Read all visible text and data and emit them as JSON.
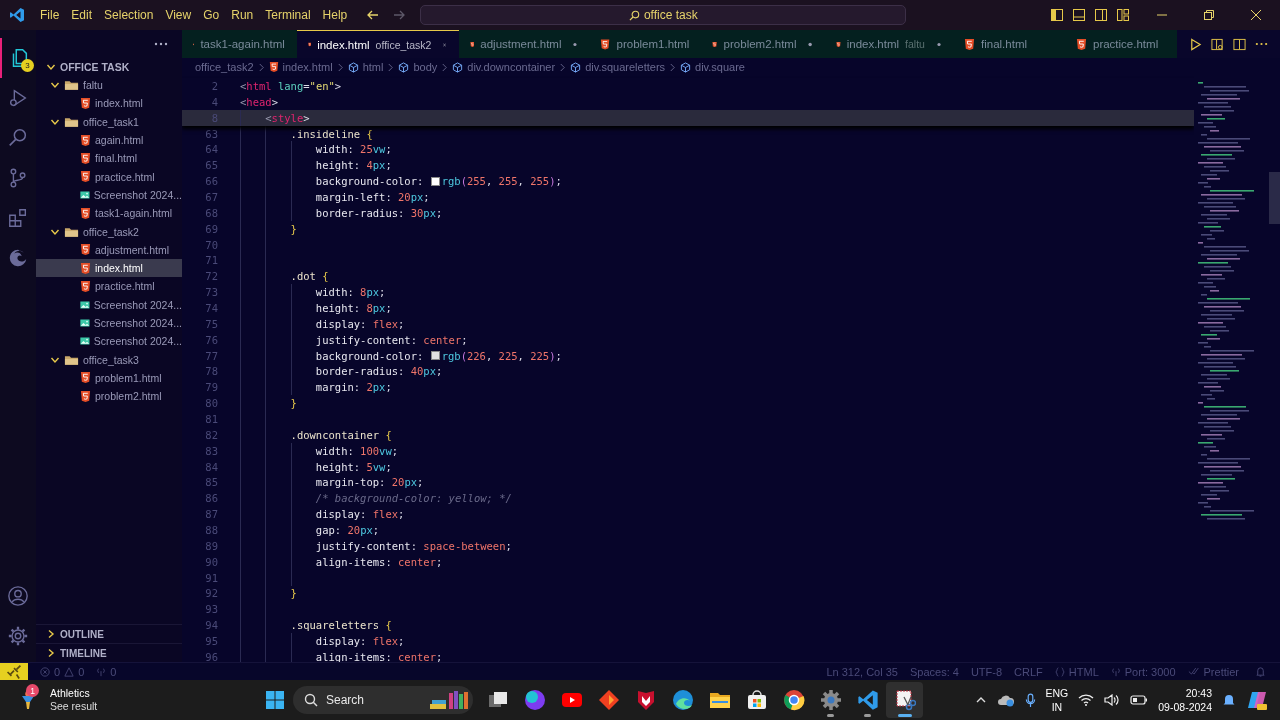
{
  "title_bar": {
    "menu": [
      "File",
      "Edit",
      "Selection",
      "View",
      "Go",
      "Run",
      "Terminal",
      "Help"
    ],
    "command_center": "office task"
  },
  "activity_bar": {
    "badge": "3"
  },
  "sidebar": {
    "section": {
      "title": "OFFICE TASK",
      "expanded": true
    },
    "tree": [
      {
        "name": "faltu",
        "kind": "folder",
        "expanded": true,
        "selected": false,
        "children": [
          {
            "name": "index.html",
            "kind": "html",
            "selected": false
          }
        ]
      },
      {
        "name": "office_task1",
        "kind": "folder",
        "expanded": true,
        "selected": false,
        "children": [
          {
            "name": "again.html",
            "kind": "html",
            "selected": false
          },
          {
            "name": "final.html",
            "kind": "html",
            "selected": false
          },
          {
            "name": "practice.html",
            "kind": "html",
            "selected": false
          },
          {
            "name": "Screenshot 2024...",
            "kind": "image",
            "selected": false
          },
          {
            "name": "task1-again.html",
            "kind": "html",
            "selected": false
          }
        ]
      },
      {
        "name": "office_task2",
        "kind": "folder",
        "expanded": true,
        "selected": false,
        "children": [
          {
            "name": "adjustment.html",
            "kind": "html",
            "selected": false
          },
          {
            "name": "index.html",
            "kind": "html",
            "selected": true
          },
          {
            "name": "practice.html",
            "kind": "html",
            "selected": false
          },
          {
            "name": "Screenshot 2024...",
            "kind": "image",
            "selected": false
          },
          {
            "name": "Screenshot 2024...",
            "kind": "image",
            "selected": false
          },
          {
            "name": "Screenshot 2024...",
            "kind": "image",
            "selected": false
          }
        ]
      },
      {
        "name": "office_task3",
        "kind": "folder",
        "expanded": true,
        "selected": false,
        "children": [
          {
            "name": "problem1.html",
            "kind": "html",
            "selected": false
          },
          {
            "name": "problem2.html",
            "kind": "html",
            "selected": false
          }
        ]
      }
    ],
    "panels": [
      {
        "title": "OUTLINE",
        "expanded": false
      },
      {
        "title": "TIMELINE",
        "expanded": false
      }
    ]
  },
  "tabs": [
    {
      "label": "task1-again.html",
      "selected": false,
      "modified": false
    },
    {
      "label": "index.html",
      "description": "office_task2",
      "selected": true,
      "modified": false
    },
    {
      "label": "adjustment.html",
      "selected": false,
      "modified": true
    },
    {
      "label": "problem1.html",
      "selected": false,
      "modified": false
    },
    {
      "label": "problem2.html",
      "selected": false,
      "modified": true
    },
    {
      "label": "index.html",
      "description": "faltu",
      "selected": false,
      "modified": true
    },
    {
      "label": "final.html",
      "selected": false,
      "modified": false
    },
    {
      "label": "practice.html",
      "selected": false,
      "modified": false
    }
  ],
  "breadcrumbs": [
    {
      "kind": "folder",
      "text": "office_task2"
    },
    {
      "kind": "file",
      "text": "index.html"
    },
    {
      "kind": "element",
      "text": "html"
    },
    {
      "kind": "element",
      "text": "body"
    },
    {
      "kind": "element",
      "text": "div.downcontainer"
    },
    {
      "kind": "element",
      "text": "div.squareletters"
    },
    {
      "kind": "element",
      "text": "div.square"
    }
  ],
  "editor": {
    "sticky_lines": [
      {
        "number": "2",
        "kind": "root",
        "highlighted": false,
        "tokens": [
          {
            "kind": "p",
            "text": "<"
          },
          {
            "kind": "tag",
            "text": "html"
          },
          {
            "kind": "attr",
            "text": " lang"
          },
          {
            "kind": "p",
            "text": "="
          },
          {
            "kind": "str",
            "text": "\"en\""
          },
          {
            "kind": "p",
            "text": ">"
          }
        ]
      },
      {
        "number": "4",
        "kind": "root",
        "highlighted": false,
        "tokens": [
          {
            "kind": "p",
            "text": "<"
          },
          {
            "kind": "tag",
            "text": "head"
          },
          {
            "kind": "p",
            "text": ">"
          }
        ]
      },
      {
        "number": "8",
        "kind": "element",
        "highlighted": true,
        "tokens": [
          {
            "kind": "p",
            "text": "<"
          },
          {
            "kind": "tag",
            "text": "style"
          },
          {
            "kind": "p",
            "text": ">"
          }
        ]
      }
    ],
    "lines": [
      {
        "number": "63",
        "kind": "rule",
        "tokens": [
          {
            "kind": "sel",
            "text": ".insideline "
          },
          {
            "kind": "brace",
            "text": "{"
          }
        ]
      },
      {
        "number": "64",
        "kind": "declaration",
        "tokens": [
          {
            "kind": "prop",
            "text": "width"
          },
          {
            "kind": "p",
            "text": ": "
          },
          {
            "kind": "num",
            "text": "25"
          },
          {
            "kind": "unit",
            "text": "vw"
          },
          {
            "kind": "p",
            "text": ";"
          }
        ]
      },
      {
        "number": "65",
        "kind": "declaration",
        "tokens": [
          {
            "kind": "prop",
            "text": "height"
          },
          {
            "kind": "p",
            "text": ": "
          },
          {
            "kind": "num",
            "text": "4"
          },
          {
            "kind": "unit",
            "text": "px"
          },
          {
            "kind": "p",
            "text": ";"
          }
        ]
      },
      {
        "number": "66",
        "kind": "declaration",
        "tokens": [
          {
            "kind": "prop",
            "text": "background-color"
          },
          {
            "kind": "p",
            "text": ": "
          },
          {
            "kind": "swatch",
            "color": "#ffffff"
          },
          {
            "kind": "fn",
            "text": "rgb"
          },
          {
            "kind": "paren",
            "text": "("
          },
          {
            "kind": "num",
            "text": "255"
          },
          {
            "kind": "p",
            "text": ", "
          },
          {
            "kind": "num",
            "text": "255"
          },
          {
            "kind": "p",
            "text": ", "
          },
          {
            "kind": "num",
            "text": "255"
          },
          {
            "kind": "paren",
            "text": ")"
          },
          {
            "kind": "p",
            "text": ";"
          }
        ]
      },
      {
        "number": "67",
        "kind": "declaration",
        "tokens": [
          {
            "kind": "prop",
            "text": "margin-left"
          },
          {
            "kind": "p",
            "text": ": "
          },
          {
            "kind": "num",
            "text": "20"
          },
          {
            "kind": "unit",
            "text": "px"
          },
          {
            "kind": "p",
            "text": ";"
          }
        ]
      },
      {
        "number": "68",
        "kind": "declaration",
        "tokens": [
          {
            "kind": "prop",
            "text": "border-radius"
          },
          {
            "kind": "p",
            "text": ": "
          },
          {
            "kind": "num",
            "text": "30"
          },
          {
            "kind": "unit",
            "text": "px"
          },
          {
            "kind": "p",
            "text": ";"
          }
        ]
      },
      {
        "number": "69",
        "kind": "rule",
        "tokens": [
          {
            "kind": "brace",
            "text": "}"
          }
        ]
      },
      {
        "number": "70",
        "kind": "rule"
      },
      {
        "number": "71",
        "kind": "rule"
      },
      {
        "number": "72",
        "kind": "rule",
        "tokens": [
          {
            "kind": "sel",
            "text": ".dot "
          },
          {
            "kind": "brace",
            "text": "{"
          }
        ]
      },
      {
        "number": "73",
        "kind": "declaration",
        "tokens": [
          {
            "kind": "prop",
            "text": "width"
          },
          {
            "kind": "p",
            "text": ": "
          },
          {
            "kind": "num",
            "text": "8"
          },
          {
            "kind": "unit",
            "text": "px"
          },
          {
            "kind": "p",
            "text": ";"
          }
        ]
      },
      {
        "number": "74",
        "kind": "declaration",
        "tokens": [
          {
            "kind": "prop",
            "text": "height"
          },
          {
            "kind": "p",
            "text": ": "
          },
          {
            "kind": "num",
            "text": "8"
          },
          {
            "kind": "unit",
            "text": "px"
          },
          {
            "kind": "p",
            "text": ";"
          }
        ]
      },
      {
        "number": "75",
        "kind": "declaration",
        "tokens": [
          {
            "kind": "prop",
            "text": "display"
          },
          {
            "kind": "p",
            "text": ": "
          },
          {
            "kind": "val",
            "text": "flex"
          },
          {
            "kind": "p",
            "text": ";"
          }
        ]
      },
      {
        "number": "76",
        "kind": "declaration",
        "tokens": [
          {
            "kind": "prop",
            "text": "justify-content"
          },
          {
            "kind": "p",
            "text": ": "
          },
          {
            "kind": "val",
            "text": "center"
          },
          {
            "kind": "p",
            "text": ";"
          }
        ]
      },
      {
        "number": "77",
        "kind": "declaration",
        "tokens": [
          {
            "kind": "prop",
            "text": "background-color"
          },
          {
            "kind": "p",
            "text": ": "
          },
          {
            "kind": "swatch",
            "color": "#e2e1e1"
          },
          {
            "kind": "fn",
            "text": "rgb"
          },
          {
            "kind": "paren",
            "text": "("
          },
          {
            "kind": "num",
            "text": "226"
          },
          {
            "kind": "p",
            "text": ", "
          },
          {
            "kind": "num",
            "text": "225"
          },
          {
            "kind": "p",
            "text": ", "
          },
          {
            "kind": "num",
            "text": "225"
          },
          {
            "kind": "paren",
            "text": ")"
          },
          {
            "kind": "p",
            "text": ";"
          }
        ]
      },
      {
        "number": "78",
        "kind": "declaration",
        "tokens": [
          {
            "kind": "prop",
            "text": "border-radius"
          },
          {
            "kind": "p",
            "text": ": "
          },
          {
            "kind": "num",
            "text": "40"
          },
          {
            "kind": "unit",
            "text": "px"
          },
          {
            "kind": "p",
            "text": ";"
          }
        ]
      },
      {
        "number": "79",
        "kind": "declaration",
        "tokens": [
          {
            "kind": "prop",
            "text": "margin"
          },
          {
            "kind": "p",
            "text": ": "
          },
          {
            "kind": "num",
            "text": "2"
          },
          {
            "kind": "unit",
            "text": "px"
          },
          {
            "kind": "p",
            "text": ";"
          }
        ]
      },
      {
        "number": "80",
        "kind": "rule",
        "tokens": [
          {
            "kind": "brace",
            "text": "}"
          }
        ]
      },
      {
        "number": "81",
        "kind": "rule"
      },
      {
        "number": "82",
        "kind": "rule",
        "tokens": [
          {
            "kind": "sel",
            "text": ".downcontainer "
          },
          {
            "kind": "brace",
            "text": "{"
          }
        ]
      },
      {
        "number": "83",
        "kind": "declaration",
        "tokens": [
          {
            "kind": "prop",
            "text": "width"
          },
          {
            "kind": "p",
            "text": ": "
          },
          {
            "kind": "num",
            "text": "100"
          },
          {
            "kind": "unit",
            "text": "vw"
          },
          {
            "kind": "p",
            "text": ";"
          }
        ]
      },
      {
        "number": "84",
        "kind": "declaration",
        "tokens": [
          {
            "kind": "prop",
            "text": "height"
          },
          {
            "kind": "p",
            "text": ": "
          },
          {
            "kind": "num",
            "text": "5"
          },
          {
            "kind": "unit",
            "text": "vw"
          },
          {
            "kind": "p",
            "text": ";"
          }
        ]
      },
      {
        "number": "85",
        "kind": "declaration",
        "tokens": [
          {
            "kind": "prop",
            "text": "margin-top"
          },
          {
            "kind": "p",
            "text": ": "
          },
          {
            "kind": "num",
            "text": "20"
          },
          {
            "kind": "unit",
            "text": "px"
          },
          {
            "kind": "p",
            "text": ";"
          }
        ]
      },
      {
        "number": "86",
        "kind": "declaration",
        "tokens": [
          {
            "kind": "comment",
            "text": "/* background-color: yellow; */"
          }
        ]
      },
      {
        "number": "87",
        "kind": "declaration",
        "tokens": [
          {
            "kind": "prop",
            "text": "display"
          },
          {
            "kind": "p",
            "text": ": "
          },
          {
            "kind": "val",
            "text": "flex"
          },
          {
            "kind": "p",
            "text": ";"
          }
        ]
      },
      {
        "number": "88",
        "kind": "declaration",
        "tokens": [
          {
            "kind": "prop",
            "text": "gap"
          },
          {
            "kind": "p",
            "text": ": "
          },
          {
            "kind": "num",
            "text": "20"
          },
          {
            "kind": "unit",
            "text": "px"
          },
          {
            "kind": "p",
            "text": ";"
          }
        ]
      },
      {
        "number": "89",
        "kind": "declaration",
        "tokens": [
          {
            "kind": "prop",
            "text": "justify-content"
          },
          {
            "kind": "p",
            "text": ": "
          },
          {
            "kind": "val",
            "text": "space-between"
          },
          {
            "kind": "p",
            "text": ";"
          }
        ]
      },
      {
        "number": "90",
        "kind": "declaration",
        "tokens": [
          {
            "kind": "prop",
            "text": "align-items"
          },
          {
            "kind": "p",
            "text": ": "
          },
          {
            "kind": "val",
            "text": "center"
          },
          {
            "kind": "p",
            "text": ";"
          }
        ]
      },
      {
        "number": "91",
        "kind": "declaration"
      },
      {
        "number": "92",
        "kind": "rule",
        "tokens": [
          {
            "kind": "brace",
            "text": "}"
          }
        ]
      },
      {
        "number": "93",
        "kind": "rule"
      },
      {
        "number": "94",
        "kind": "rule",
        "tokens": [
          {
            "kind": "sel",
            "text": ".squareletters "
          },
          {
            "kind": "brace",
            "text": "{"
          }
        ]
      },
      {
        "number": "95",
        "kind": "declaration",
        "tokens": [
          {
            "kind": "prop",
            "text": "display"
          },
          {
            "kind": "p",
            "text": ": "
          },
          {
            "kind": "val",
            "text": "flex"
          },
          {
            "kind": "p",
            "text": ";"
          }
        ]
      },
      {
        "number": "96",
        "kind": "declaration",
        "tokens": [
          {
            "kind": "prop",
            "text": "align-items"
          },
          {
            "kind": "p",
            "text": ": "
          },
          {
            "kind": "val",
            "text": "center"
          },
          {
            "kind": "p",
            "text": ";"
          }
        ]
      }
    ]
  },
  "status_bar": {
    "errors": "0",
    "warnings": "0",
    "ports": "0",
    "items": [
      {
        "kind": "text",
        "text": "Ln 312, Col 35"
      },
      {
        "kind": "text",
        "text": "Spaces: 4"
      },
      {
        "kind": "text",
        "text": "UTF-8"
      },
      {
        "kind": "text",
        "text": "CRLF"
      },
      {
        "kind": "language",
        "text": "HTML"
      },
      {
        "kind": "port",
        "text": "Port: 3000"
      },
      {
        "kind": "formatter",
        "text": "Prettier"
      }
    ]
  },
  "taskbar": {
    "widget": {
      "title": "Athletics",
      "subtitle": "See result",
      "badge": "1"
    },
    "search": {
      "label": "Search"
    },
    "apps": [
      {
        "kind": "task-view",
        "running": false,
        "active": false
      },
      {
        "kind": "circle",
        "running": false,
        "active": false
      },
      {
        "kind": "play",
        "running": false,
        "active": false
      },
      {
        "kind": "diamond",
        "running": false,
        "active": false
      },
      {
        "kind": "shield",
        "running": false,
        "active": false
      },
      {
        "kind": "swirl",
        "running": false,
        "active": false
      },
      {
        "kind": "folder",
        "running": false,
        "active": false
      },
      {
        "kind": "store",
        "running": false,
        "active": false
      },
      {
        "kind": "ring",
        "running": false,
        "active": false
      },
      {
        "kind": "gear",
        "running": true,
        "active": false
      },
      {
        "kind": "ribbon",
        "running": true,
        "active": false
      },
      {
        "kind": "scissors",
        "running": true,
        "active": true
      }
    ],
    "tray": {
      "language": "ENG",
      "region": "IN",
      "time": "20:43",
      "date": "09-08-2024"
    }
  }
}
